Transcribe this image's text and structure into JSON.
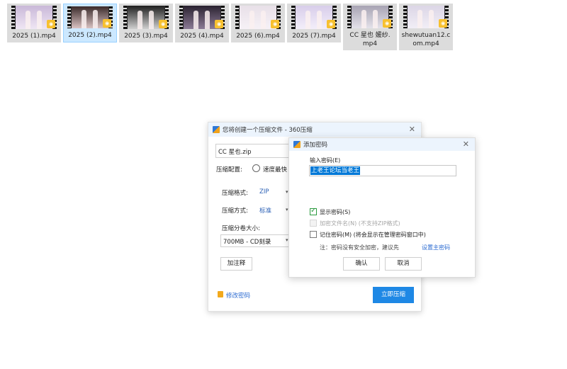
{
  "files": [
    {
      "name": "2025 (1).mp4",
      "selected": false
    },
    {
      "name": "2025 (2).mp4",
      "selected": true
    },
    {
      "name": "2025 (3).mp4",
      "selected": false
    },
    {
      "name": "2025 (4).mp4",
      "selected": false
    },
    {
      "name": "2025 (6).mp4",
      "selected": false
    },
    {
      "name": "2025 (7).mp4",
      "selected": false
    },
    {
      "name": "CC 星也 媛纱.\nmp4",
      "selected": false
    },
    {
      "name": "shewutuan12.c\nom.mp4",
      "selected": false
    }
  ],
  "player_badge": "Player",
  "main_dialog": {
    "title": "您将创建一个压缩文件 - 360压缩",
    "close": "✕",
    "filename": "CC 星也.zip",
    "config_label": "压缩配置:",
    "config_option": "速度最快",
    "format_label": "压缩格式:",
    "format_value": "ZIP",
    "method_label": "压缩方式:",
    "method_value": "标准",
    "split_label": "压缩分卷大小:",
    "split_value": "700MB  - CD刻录",
    "comment_button": "加注释",
    "change_password": "修改密码",
    "compress_button": "立即压缩"
  },
  "password_dialog": {
    "title": "添加密码",
    "close": "✕",
    "input_label": "输入密码(E)",
    "password_value": "上老王论坛当老王",
    "show_password": "显示密码(S)",
    "show_password_checked": true,
    "encrypt_names": "加密文件名(N) (不支持ZIP格式)",
    "remember": "记住密码(M) (将会显示在管理密码窗口中)",
    "note": "注：密码没有安全加密，建议先",
    "note_link": "设置主密码",
    "ok": "确认",
    "cancel": "取消"
  }
}
